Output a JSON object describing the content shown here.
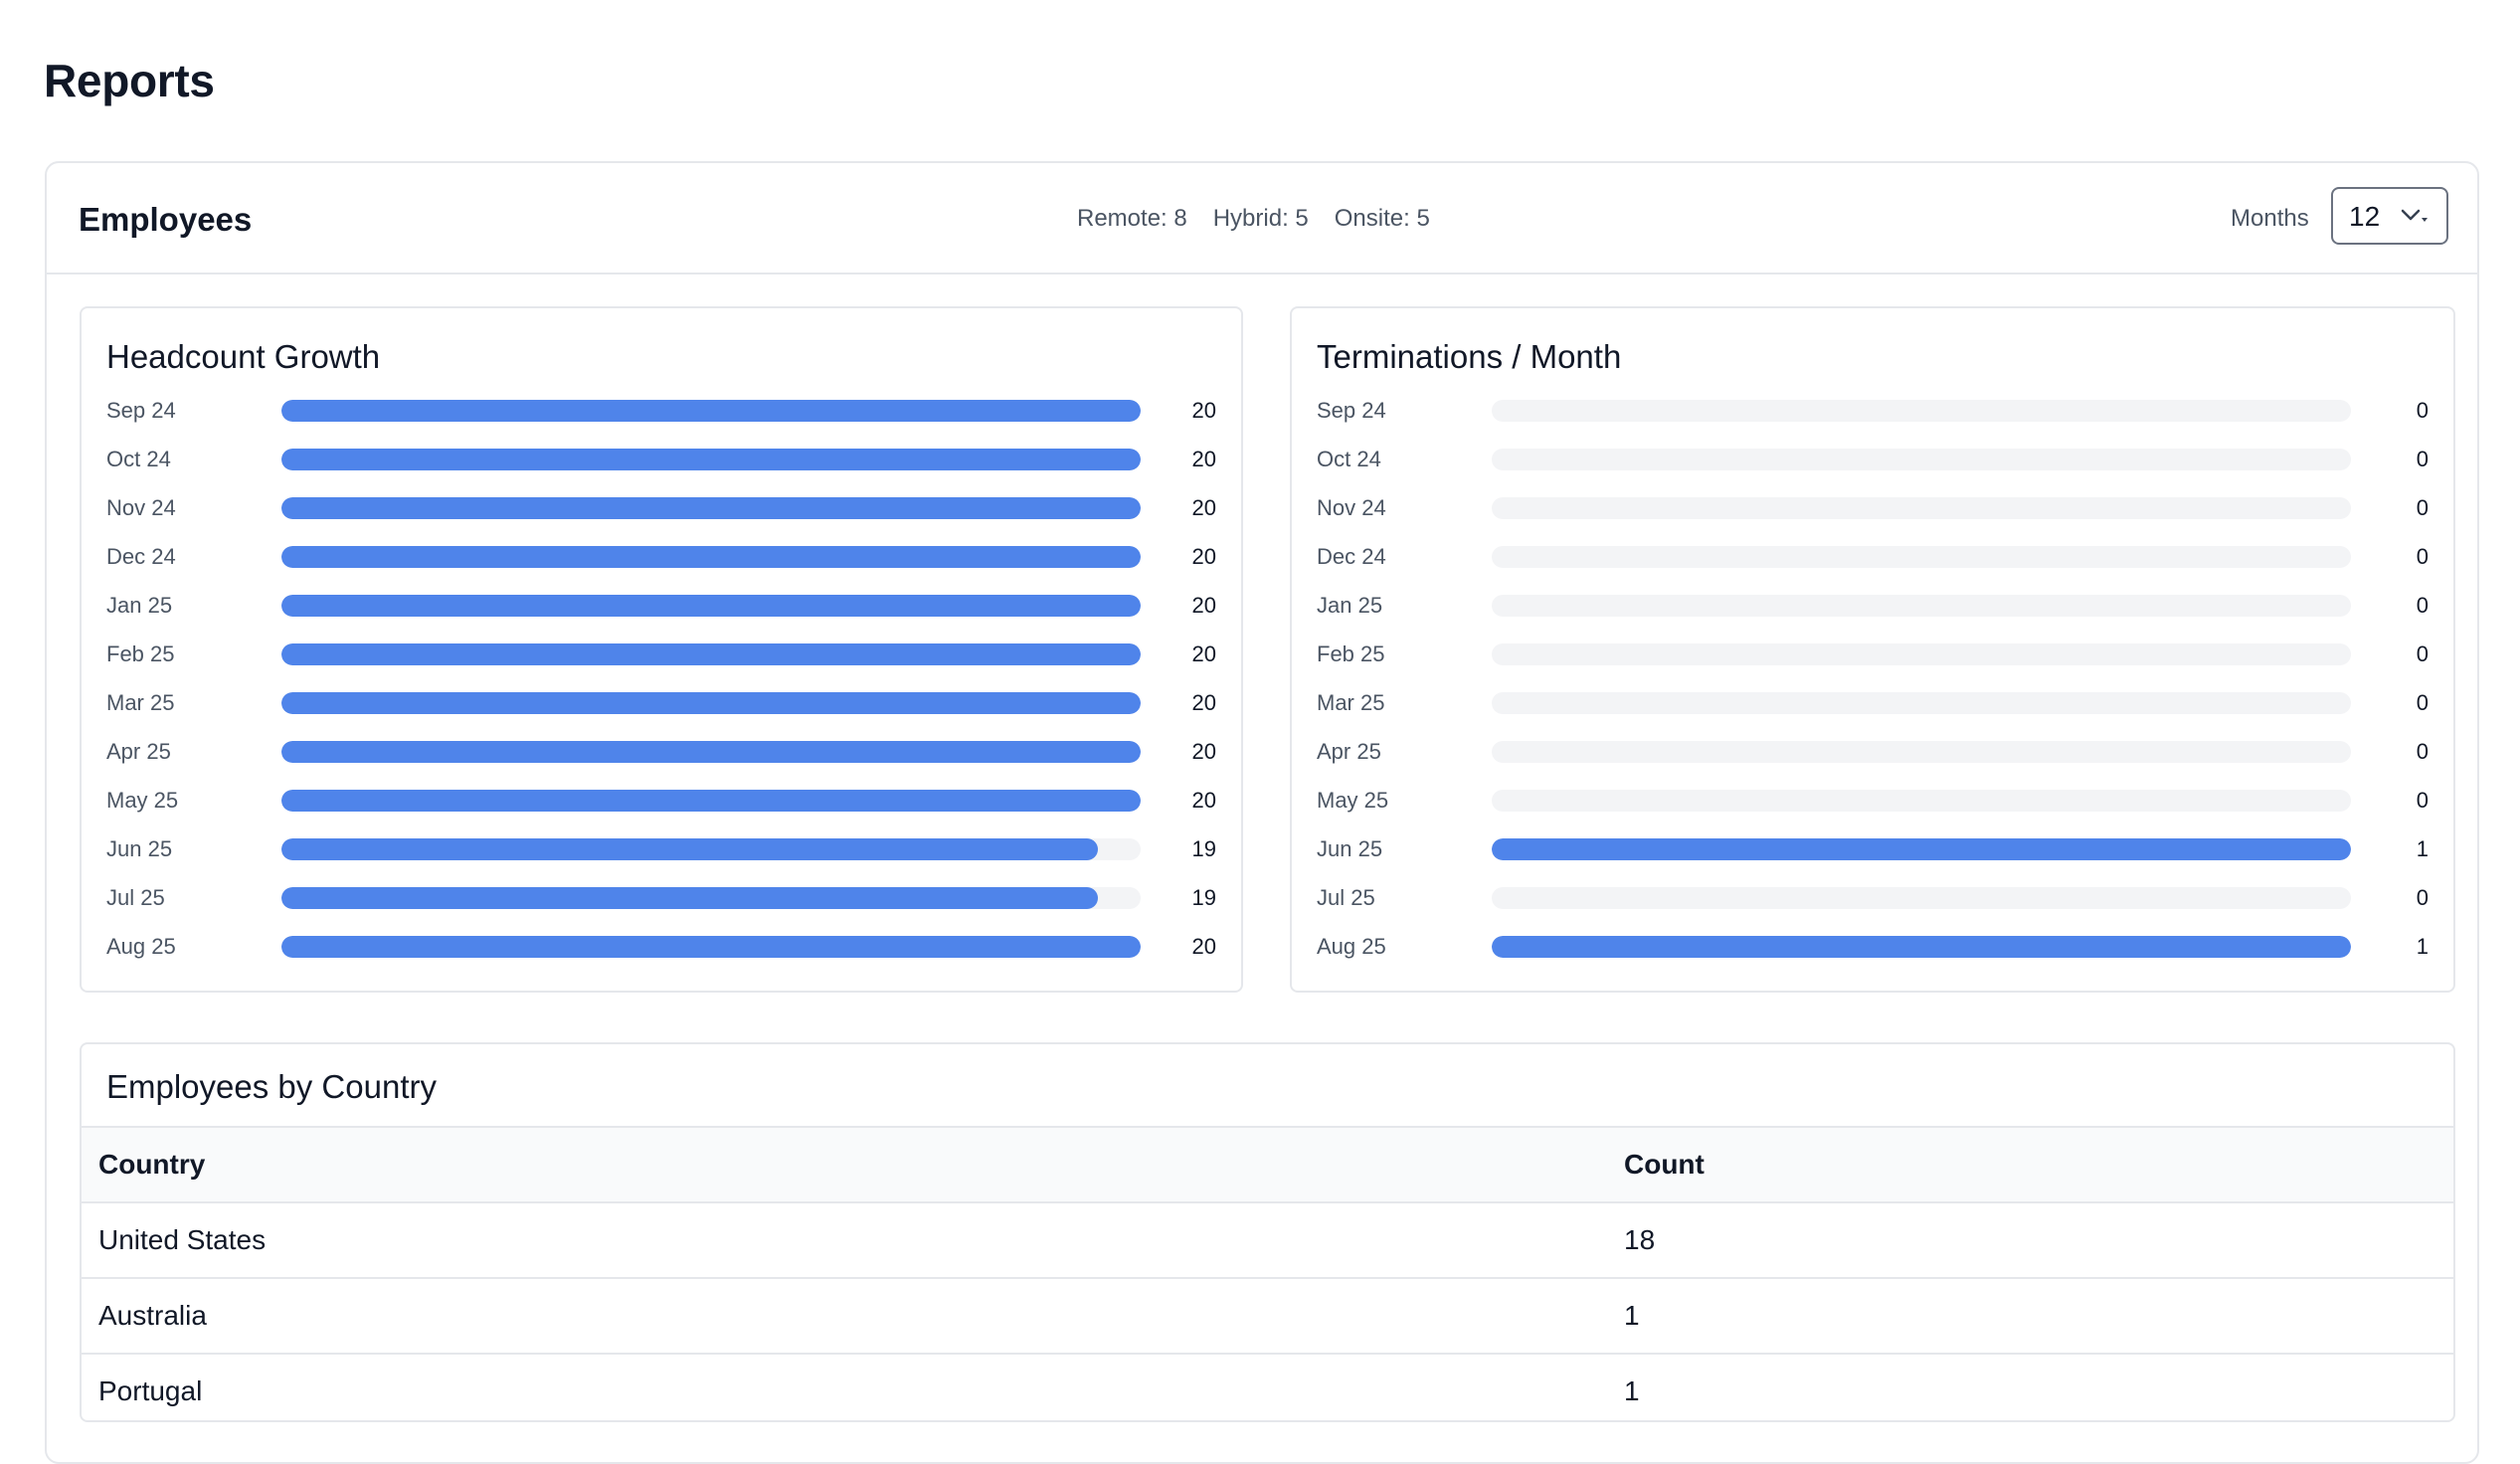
{
  "page": {
    "title": "Reports"
  },
  "card": {
    "title": "Employees",
    "mode_stats": [
      "Remote: 8",
      "Hybrid: 5",
      "Onsite: 5"
    ],
    "months_label": "Months",
    "months_value": "12"
  },
  "colors": {
    "bar": "#4f84ea",
    "track": "#f3f4f6"
  },
  "icons": {
    "select_caret": "chevron-down-icon"
  },
  "chart_data": [
    {
      "type": "bar",
      "orientation": "horizontal",
      "title": "Headcount Growth",
      "categories": [
        "Sep 24",
        "Oct 24",
        "Nov 24",
        "Dec 24",
        "Jan 25",
        "Feb 25",
        "Mar 25",
        "Apr 25",
        "May 25",
        "Jun 25",
        "Jul 25",
        "Aug 25"
      ],
      "values": [
        20,
        20,
        20,
        20,
        20,
        20,
        20,
        20,
        20,
        19,
        19,
        20
      ],
      "xlim": [
        0,
        20
      ]
    },
    {
      "type": "bar",
      "orientation": "horizontal",
      "title": "Terminations / Month",
      "categories": [
        "Sep 24",
        "Oct 24",
        "Nov 24",
        "Dec 24",
        "Jan 25",
        "Feb 25",
        "Mar 25",
        "Apr 25",
        "May 25",
        "Jun 25",
        "Jul 25",
        "Aug 25"
      ],
      "values": [
        0,
        0,
        0,
        0,
        0,
        0,
        0,
        0,
        0,
        1,
        0,
        1
      ],
      "xlim": [
        0,
        1
      ]
    }
  ],
  "countries": {
    "title": "Employees by Country",
    "columns": [
      "Country",
      "Count"
    ],
    "rows": [
      [
        "United States",
        "18"
      ],
      [
        "Australia",
        "1"
      ],
      [
        "Portugal",
        "1"
      ]
    ]
  }
}
